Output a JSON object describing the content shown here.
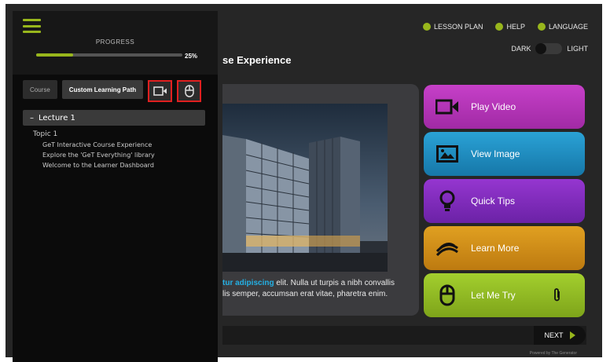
{
  "header": {
    "links": [
      {
        "label": "LESSON PLAN",
        "icon": "lesson-plan-icon"
      },
      {
        "label": "HELP",
        "icon": "help-icon"
      },
      {
        "label": "LANGUAGE",
        "icon": "globe-icon"
      }
    ],
    "theme": {
      "dark_label": "DARK",
      "light_label": "LIGHT",
      "current": "dark"
    }
  },
  "course": {
    "title_visible": "se Experience"
  },
  "content": {
    "text_highlight": "tur adipiscing",
    "text_line1": " elit. Nulla ut turpis a nibh convallis",
    "text_line2": "lis semper, accumsan erat vitae, pharetra enim."
  },
  "actions": [
    {
      "label": "Play Video",
      "icon": "video-camera-icon",
      "color": "#b535b8"
    },
    {
      "label": "View Image",
      "icon": "image-icon",
      "color": "#1f8fc4"
    },
    {
      "label": "Quick Tips",
      "icon": "lightbulb-icon",
      "color": "#8530c0"
    },
    {
      "label": "Learn More",
      "icon": "layers-icon",
      "color": "#d28e18"
    },
    {
      "label": "Let Me Try",
      "icon": "mouse-icon",
      "color": "#93bf25"
    }
  ],
  "footer": {
    "next_label": "NEXT",
    "powered_by": "Powered by The Generator"
  },
  "sidepanel": {
    "progress_label": "PROGRESS",
    "progress_value": 0.25,
    "progress_text": "25%",
    "path_tabs": [
      "Course",
      "Custom Learning Path"
    ],
    "lecture": {
      "toggle": "–",
      "label": "Lecture 1"
    },
    "topic": "Topic 1",
    "lessons": [
      "GeT Interactive Course Experience",
      "Explore the 'GeT Everything' library",
      "Welcome to the Learner Dashboard"
    ]
  },
  "colors": {
    "accent": "#98b61c",
    "highlight_box": "#e02020",
    "link_text": "#24b0e4"
  }
}
